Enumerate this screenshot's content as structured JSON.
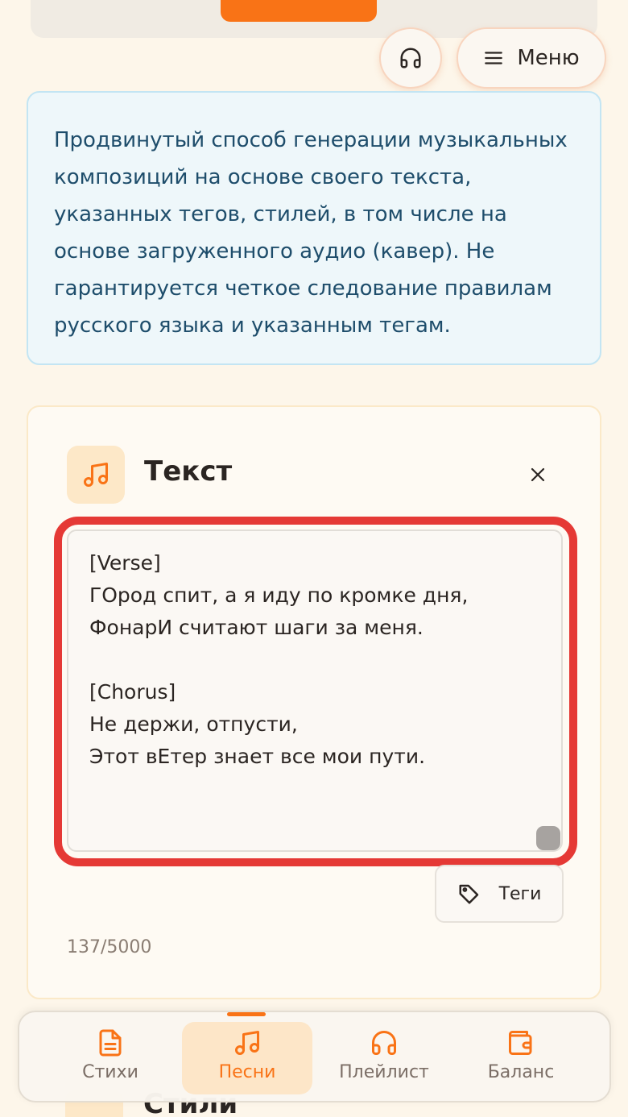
{
  "header": {
    "listen_icon": "headphones-icon",
    "menu_label": "Меню"
  },
  "info": {
    "text": "Продвинутый способ генерации музыкальных композиций на основе своего текста, указанных тегов, стилей, в том числе на основе загруженного аудио (кавер). Не гарантируется четкое следование правилам русского языка и указанным тегам."
  },
  "lyrics_card": {
    "title": "Текст",
    "text": "[Verse]\nГОрод спит, а я иду по кромке дня,\nФонарИ считают шаги за меня.\n\n[Chorus]\nНе держи, отпусти,\nЭтот вЕтер знает все мои пути.",
    "tags_label": "Теги",
    "counter": "137/5000"
  },
  "styles_card": {
    "title": "Стили"
  },
  "bottom_nav": {
    "items": [
      {
        "label": "Стихи",
        "icon": "document-icon"
      },
      {
        "label": "Песни",
        "icon": "music-note-icon"
      },
      {
        "label": "Плейлист",
        "icon": "headphones-icon"
      },
      {
        "label": "Баланс",
        "icon": "wallet-icon"
      }
    ],
    "active": "Песни"
  },
  "colors": {
    "accent": "#f97316",
    "highlight": "#e53935",
    "info_text": "#1e4d6b"
  }
}
